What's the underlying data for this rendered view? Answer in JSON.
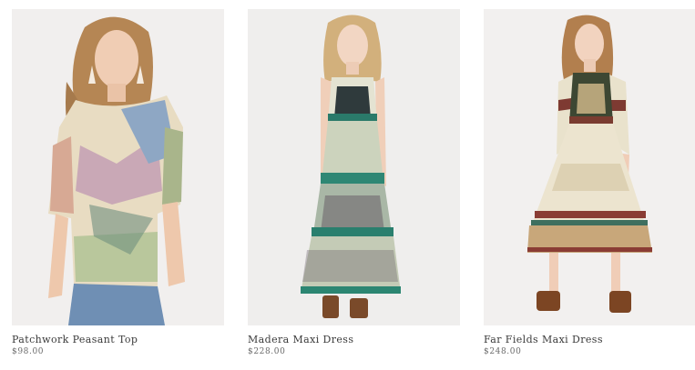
{
  "products": [
    {
      "title": "Patchwork Peasant Top",
      "price": "$98.00",
      "image": "model-wearing-patchwork-peasant-top-photo",
      "background": "#f1efee"
    },
    {
      "title": "Madera Maxi Dress",
      "price": "$228.00",
      "image": "model-wearing-madera-maxi-dress-photo",
      "background": "#efeeed"
    },
    {
      "title": "Far Fields Maxi Dress",
      "price": "$248.00",
      "image": "model-wearing-far-fields-maxi-dress-photo",
      "background": "#f2f0ef"
    }
  ],
  "colors": {
    "title_text": "#3a3a3a",
    "price_text": "#6a6a6a",
    "page_background": "#ffffff"
  }
}
